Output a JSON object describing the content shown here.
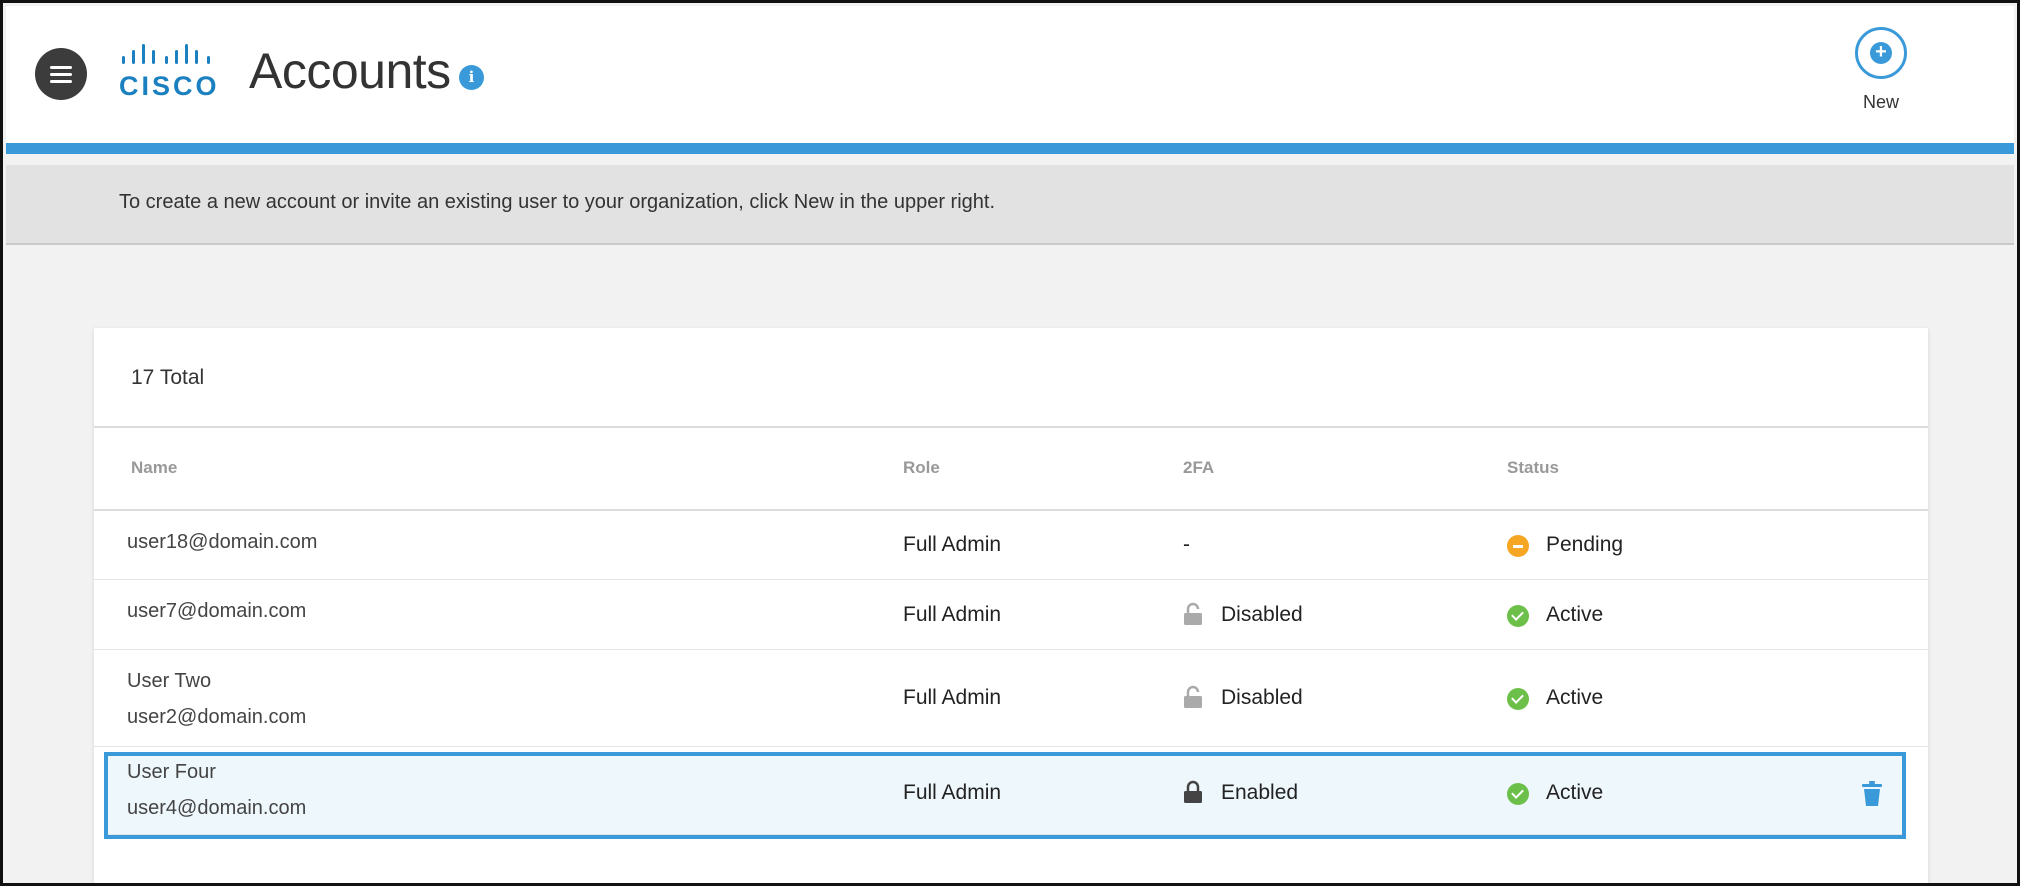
{
  "header": {
    "title": "Accounts",
    "logo_text": "CISCO",
    "info_icon": "i",
    "new_button_label": "New",
    "new_button_icon": "+"
  },
  "banner": {
    "text": "To create a new account or invite an existing user to your organization, click New in the upper right."
  },
  "accounts": {
    "total": "17 Total",
    "columns": [
      "Name",
      "Role",
      "2FA",
      "Status"
    ],
    "rows": [
      {
        "name": "",
        "email": "user18@domain.com",
        "role": "Full Admin",
        "twofa": "-",
        "twofa_icon": "",
        "status": "Pending",
        "status_icon": "pending-icon"
      },
      {
        "name": "",
        "email": "user7@domain.com",
        "role": "Full Admin",
        "twofa": "Disabled",
        "twofa_icon": "unlocked-icon",
        "status": "Active",
        "status_icon": "check-icon"
      },
      {
        "name": "User Two",
        "email": "user2@domain.com",
        "role": "Full Admin",
        "twofa": "Disabled",
        "twofa_icon": "unlocked-icon",
        "status": "Active",
        "status_icon": "check-icon"
      },
      {
        "name": "User Four",
        "email": "user4@domain.com",
        "role": "Full Admin",
        "twofa": "Enabled",
        "twofa_icon": "locked-icon",
        "status": "Active",
        "status_icon": "check-icon",
        "selected": true
      }
    ]
  },
  "colors": {
    "accent": "#3a9ad9",
    "active": "#6cc04a",
    "pending": "#f5a623"
  }
}
